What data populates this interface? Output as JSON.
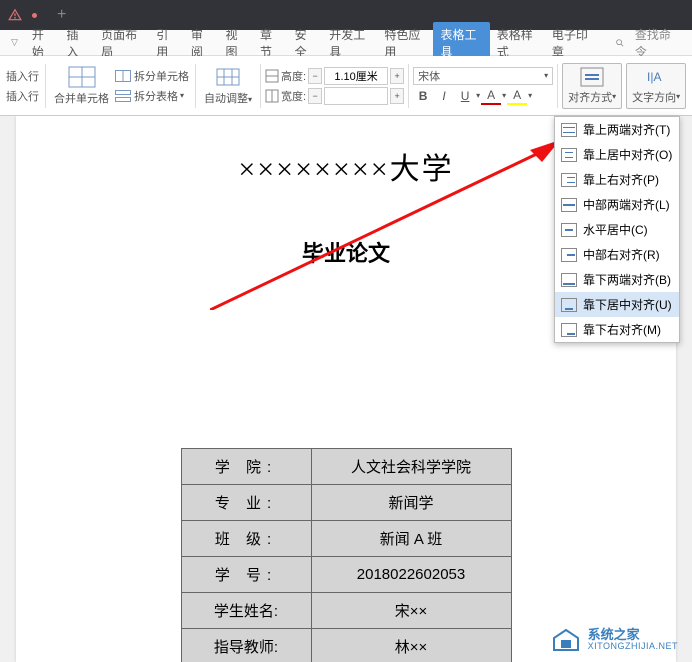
{
  "menubar": {
    "items": [
      "开始",
      "插入",
      "页面布局",
      "引用",
      "审阅",
      "视图",
      "章节",
      "安全",
      "开发工具",
      "特色应用"
    ],
    "active": "表格工具",
    "after": [
      "表格样式",
      "电子印章"
    ],
    "search_placeholder": "查找命令"
  },
  "ribbon": {
    "insert_row": "插入行",
    "merge_cells": "合并单元格",
    "split_cells": "拆分单元格",
    "split_table": "拆分表格",
    "auto_fit": "自动调整",
    "height_label": "高度:",
    "width_label": "宽度:",
    "height_value": "1.10厘米",
    "width_value": "",
    "font_name": "宋体",
    "align_label": "对齐方式",
    "text_dir_label": "文字方向"
  },
  "dropdown": {
    "items": [
      "靠上两端对齐(T)",
      "靠上居中对齐(O)",
      "靠上右对齐(P)",
      "中部两端对齐(L)",
      "水平居中(C)",
      "中部右对齐(R)",
      "靠下两端对齐(B)",
      "靠下居中对齐(U)",
      "靠下右对齐(M)"
    ],
    "highlighted_index": 7
  },
  "document": {
    "title": "××××××××大学",
    "subtitle": "毕业论文",
    "table": [
      {
        "label": "学 院:",
        "value": "人文社会科学学院"
      },
      {
        "label": "专 业:",
        "value": "新闻学"
      },
      {
        "label": "班 级:",
        "value": "新闻 A 班"
      },
      {
        "label": "学 号:",
        "value": "2018022602053"
      },
      {
        "label": "学生姓名:",
        "value": "宋××"
      },
      {
        "label": "指导教师:",
        "value": "林××"
      }
    ]
  },
  "watermark": {
    "cn": "系统之家",
    "en": "XITONGZHIJIA.NET"
  }
}
